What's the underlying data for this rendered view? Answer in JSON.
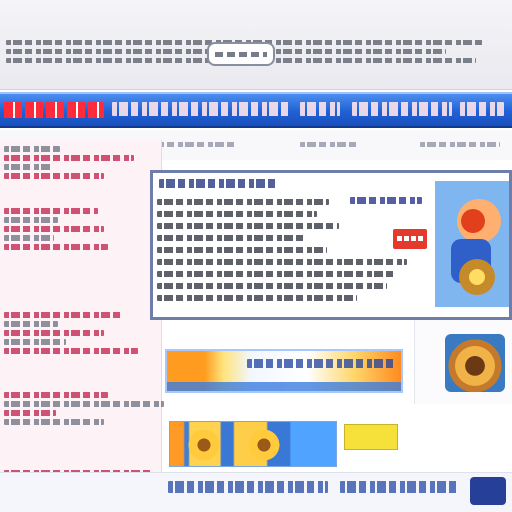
{
  "colors": {
    "nav_blue": "#2061d6",
    "nav_title_red": "#ff2a3a",
    "sidebar_pink": "#fdf2f6",
    "link_red": "#c01b47",
    "feature_border": "#6f7ea8",
    "promo_badge_red": "#e43a2e",
    "banner_orange": "#ff9b1f",
    "tag_yellow": "#f6e13a"
  },
  "icons": {
    "logo": "logo-icon",
    "promo_art": "illustration-icon",
    "thumbnail": "image-icon",
    "footer_logo": "logo-icon"
  }
}
